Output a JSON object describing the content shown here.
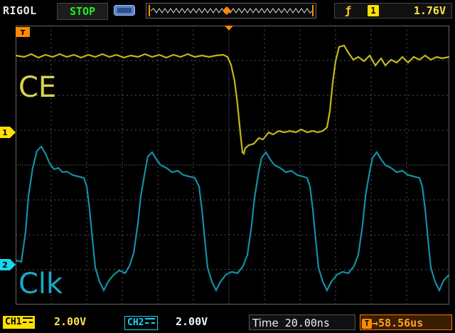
{
  "header": {
    "brand": "RIGOL",
    "run_state": "STOP",
    "trigger": {
      "edge_icon": "rising-edge-icon",
      "source_channel": "1",
      "level": "1.76V"
    }
  },
  "waveforms": {
    "ce": {
      "label": "CE",
      "color": "#c4b61e"
    },
    "clk": {
      "label": "Clk",
      "color": "#138fa6"
    }
  },
  "markers": {
    "trigger_marker": "T",
    "ch1_ground": "1",
    "ch2_ground": "2"
  },
  "footer": {
    "ch1": {
      "name": "CH1",
      "scale": "2.00V"
    },
    "ch2": {
      "name": "CH2",
      "scale": "2.00V"
    },
    "time": {
      "label": "Time",
      "value": "20.00ns"
    },
    "trigger_delay": "58.56us"
  }
}
